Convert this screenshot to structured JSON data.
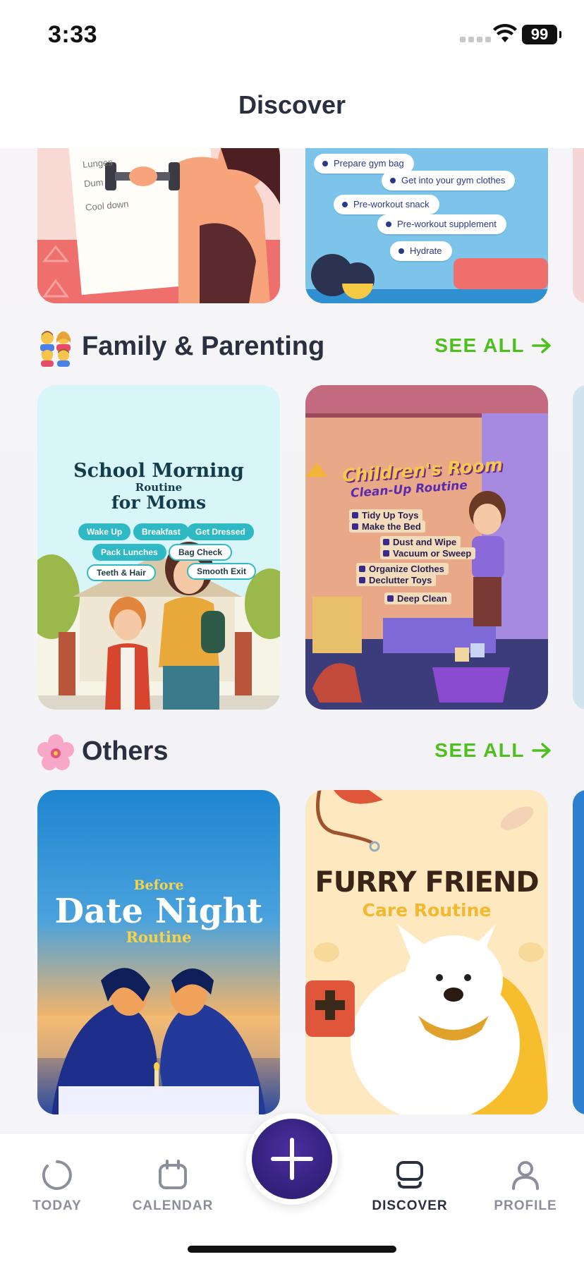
{
  "status_bar": {
    "time": "3:33",
    "battery": "99"
  },
  "header": {
    "title": "Discover"
  },
  "top_row": {
    "card1": {
      "notes": [
        "Lunges",
        "Dum",
        "Cool down"
      ]
    },
    "card2": {
      "bubbles": [
        "Prepare gym bag",
        "Get into your gym clothes",
        "Pre-workout snack",
        "Pre-workout supplement",
        "Hydrate"
      ]
    }
  },
  "sections": [
    {
      "title": "Family & Parenting",
      "emoji": "family-emoji",
      "see_all": "SEE ALL",
      "cards": [
        {
          "title_line1": "School Morning",
          "title_line2": "Routine",
          "title_line3": "for Moms",
          "pills": [
            "Wake Up",
            "Breakfast",
            "Get Dressed",
            "Pack Lunches",
            "Bag Check",
            "Teeth & Hair",
            "Smooth Exit"
          ]
        },
        {
          "title_line1": "Children's Room",
          "title_line2": "Clean-Up Routine",
          "items": [
            "Tidy Up Toys",
            "Make the Bed",
            "Dust and Wipe",
            "Vacuum or Sweep",
            "Organize Clothes",
            "Declutter Toys",
            "Deep Clean"
          ]
        }
      ]
    },
    {
      "title": "Others",
      "emoji": "cherry-blossom-emoji",
      "see_all": "SEE ALL",
      "cards": [
        {
          "title_pre": "Before",
          "title_main": "Date Night",
          "title_post": "Routine"
        },
        {
          "title_main": "FURRY FRIEND",
          "title_sub": "Care Routine"
        }
      ]
    }
  ],
  "tabbar": {
    "tabs": [
      {
        "label": "TODAY",
        "icon": "circle-progress-icon"
      },
      {
        "label": "CALENDAR",
        "icon": "calendar-icon"
      },
      {
        "label": "DISCOVER",
        "icon": "stack-icon"
      },
      {
        "label": "PROFILE",
        "icon": "person-icon"
      }
    ],
    "active": "DISCOVER",
    "fab_icon": "plus-icon"
  },
  "colors": {
    "accent_green": "#4dc01c",
    "fab_purple": "#32207a",
    "text_dark": "#2b3040",
    "tab_inactive": "#8b8f9c"
  }
}
